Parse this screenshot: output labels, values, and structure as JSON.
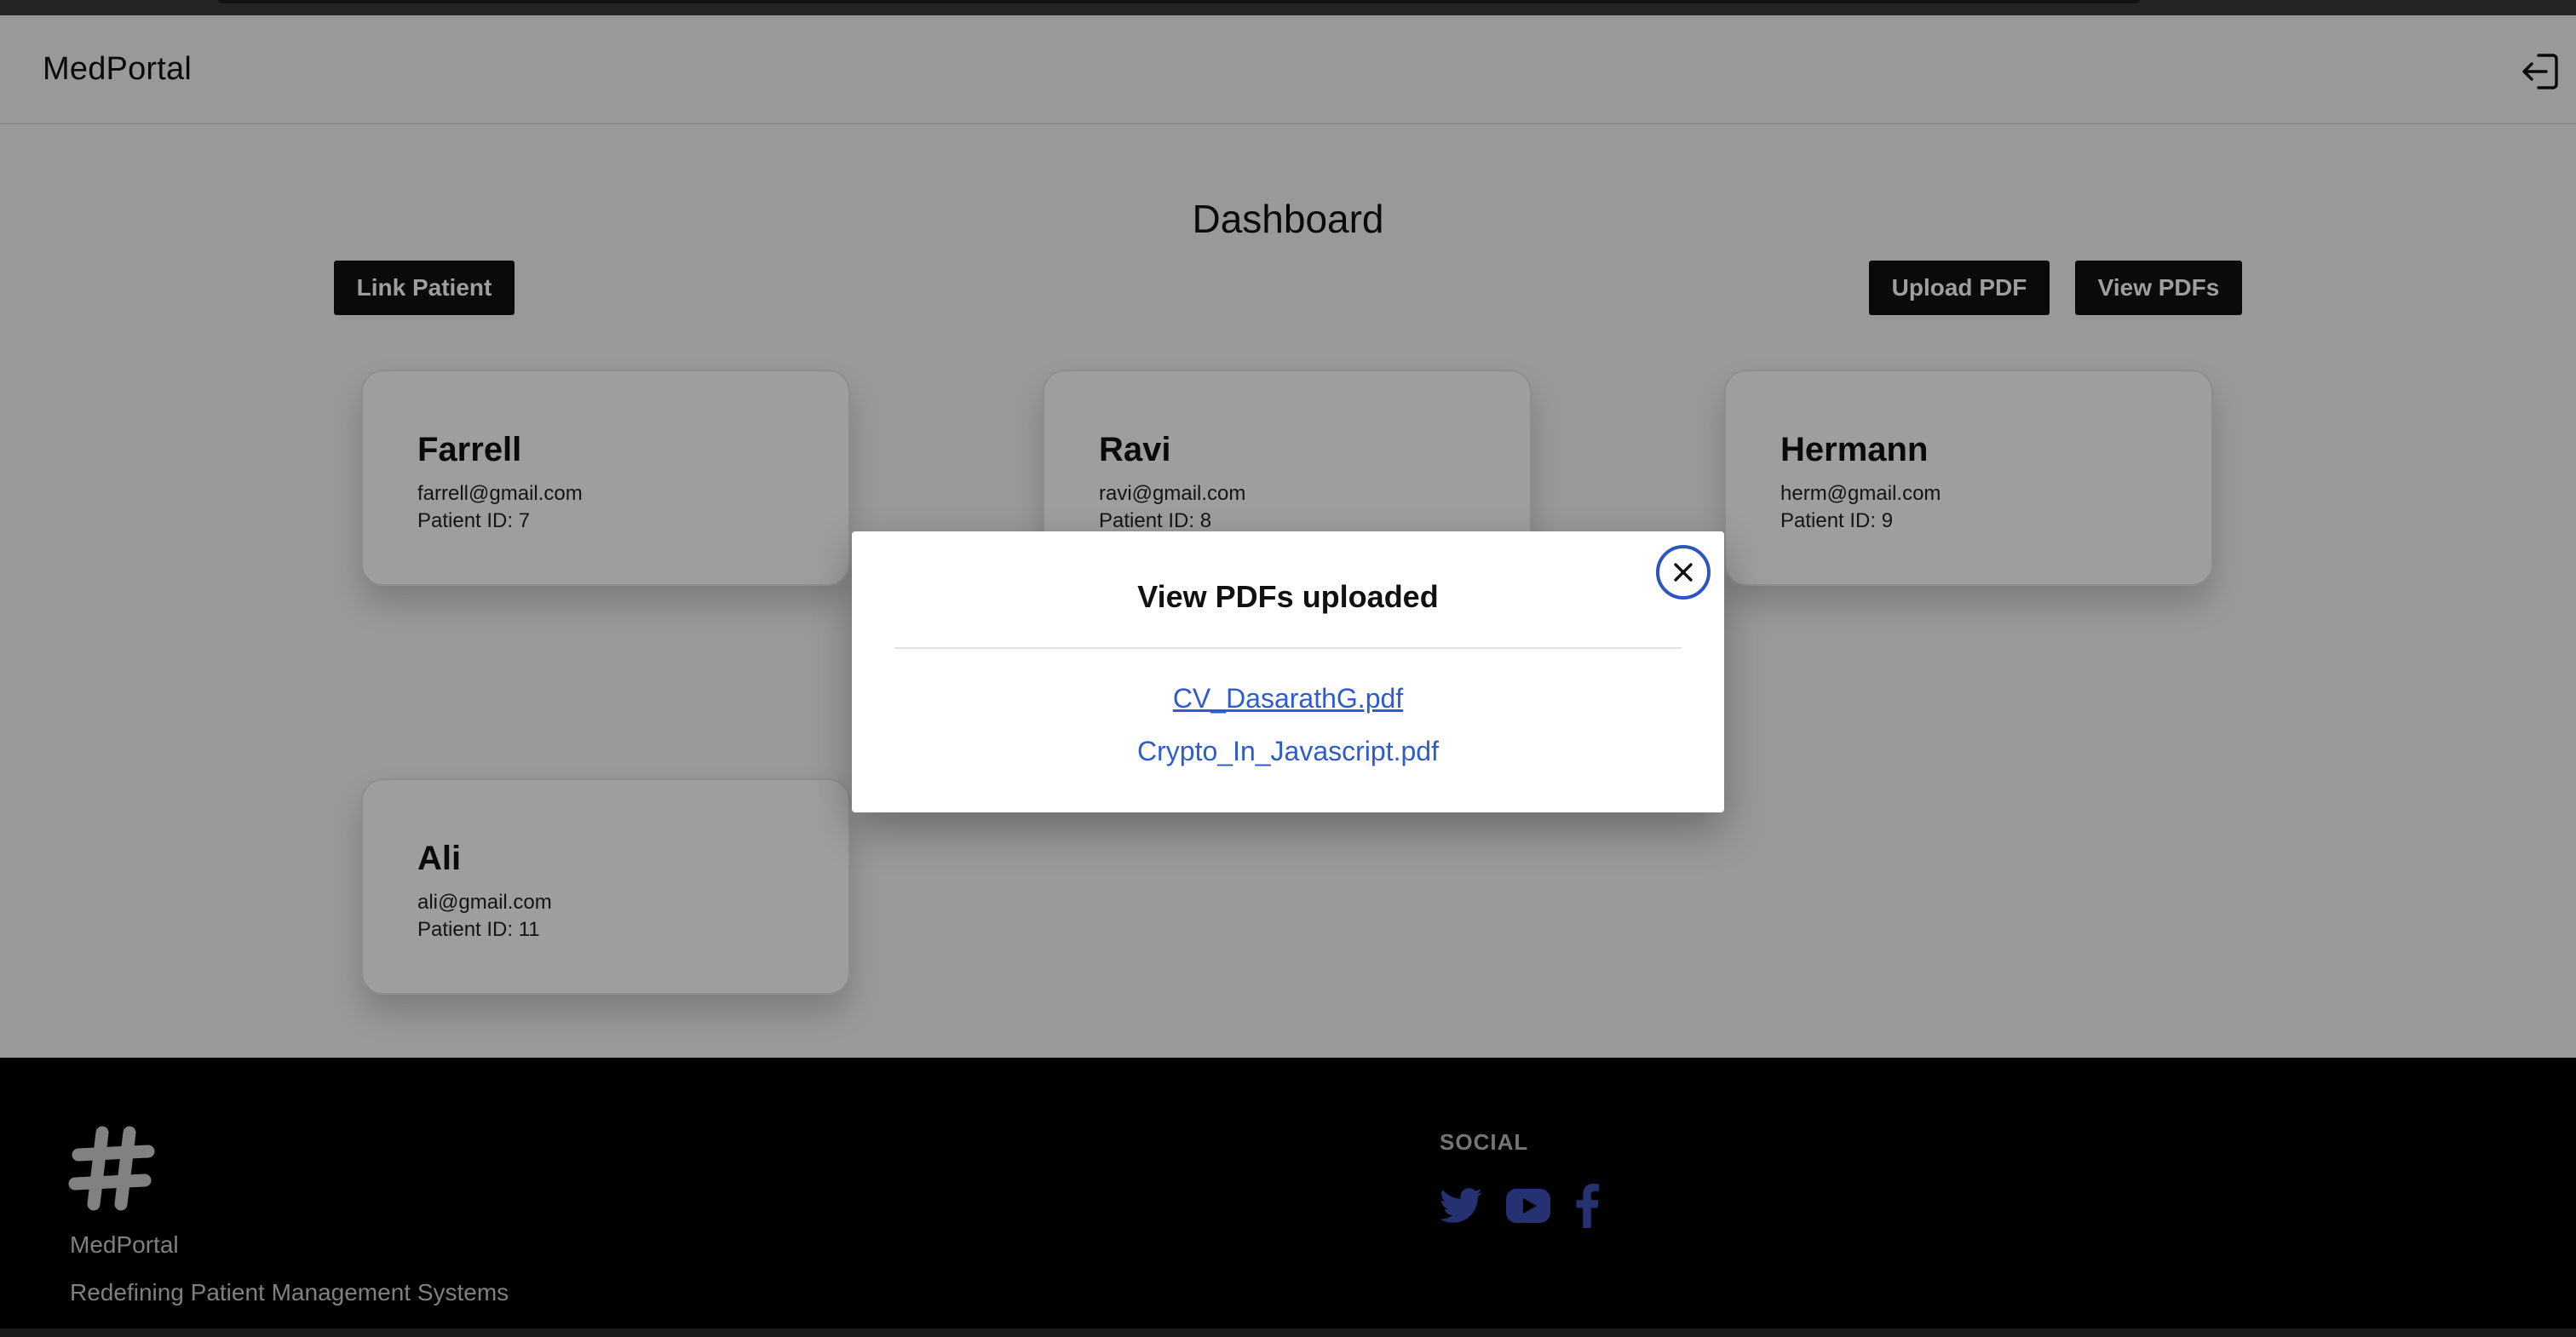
{
  "header": {
    "brand": "MedPortal",
    "logout_icon": "logout-icon"
  },
  "dashboard": {
    "title": "Dashboard",
    "link_patient_label": "Link Patient",
    "upload_pdf_label": "Upload PDF",
    "view_pdfs_label": "View PDFs"
  },
  "patients": [
    {
      "name": "Farrell",
      "email": "farrell@gmail.com",
      "patient_id": "Patient ID: 7"
    },
    {
      "name": "Ravi",
      "email": "ravi@gmail.com",
      "patient_id": "Patient ID: 8"
    },
    {
      "name": "Hermann",
      "email": "herm@gmail.com",
      "patient_id": "Patient ID: 9"
    },
    {
      "name": "Ali",
      "email": "ali@gmail.com",
      "patient_id": "Patient ID: 11"
    }
  ],
  "modal": {
    "title": "View PDFs uploaded",
    "files": [
      "CV_DasarathG.pdf",
      "Crypto_In_Javascript.pdf"
    ],
    "close_icon": "close-icon"
  },
  "footer": {
    "name": "MedPortal",
    "tagline": "Redefining Patient Management Systems",
    "social_heading": "SOCIAL",
    "social_icons": [
      "twitter-icon",
      "youtube-icon",
      "facebook-icon"
    ],
    "logo_icon": "hash-logo-icon"
  },
  "colors": {
    "button_bg": "#111111",
    "link": "#2f5ccc",
    "social_icon": "#3d4fb5",
    "footer_bg": "#000000"
  }
}
